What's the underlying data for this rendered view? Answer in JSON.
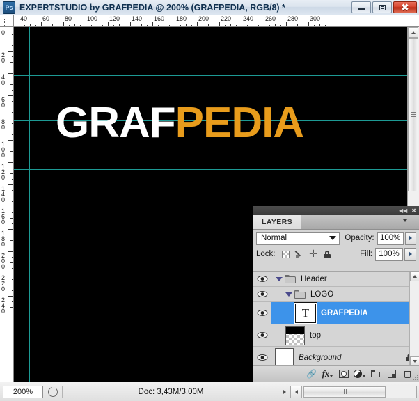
{
  "window": {
    "app_icon": "photoshop-icon",
    "title": "EXPERTSTUDIO by GRAFPEDIA @ 200% (GRAFPEDIA, RGB/8) *",
    "minimize_label": "",
    "maximize_label": "",
    "close_label": "✖"
  },
  "rulers": {
    "unit_origin": "0",
    "horizontal_labels": [
      "40",
      "60",
      "80",
      "100",
      "120",
      "140",
      "160",
      "180",
      "200",
      "220",
      "240",
      "260",
      "280",
      "300"
    ],
    "vertical_labels": [
      "0",
      "20",
      "40",
      "60",
      "80",
      "100",
      "120",
      "140",
      "160",
      "180",
      "200",
      "220",
      "240"
    ]
  },
  "canvas": {
    "background_color": "#000000",
    "guide_color": "#1d9a94",
    "logo_part_1": "GRAF",
    "logo_part_1_color": "#ffffff",
    "logo_part_2": "PEDIA",
    "logo_part_2_color": "#e89c1c"
  },
  "statusbar": {
    "zoom_level": "200%",
    "preview_icon": "document-preview-icon",
    "doc_info": "Doc: 3,43M/3,00M",
    "expand_arrow": "▶"
  },
  "layers_panel": {
    "collapse_icon": "◀◀",
    "close_icon": "✖",
    "tab_label": "LAYERS",
    "menu_icon": "panel-menu-icon",
    "blend_mode": "Normal",
    "blend_modes": [
      "Normal"
    ],
    "opacity_label": "Opacity:",
    "opacity_value": "100%",
    "lock_label": "Lock:",
    "lock_icons": [
      "lock-transparent-pixels-icon",
      "lock-image-pixels-icon",
      "lock-position-icon",
      "lock-all-icon"
    ],
    "fill_label": "Fill:",
    "fill_value": "100%",
    "rows": [
      {
        "name": "Header",
        "type": "group",
        "visible": true,
        "expanded": true,
        "indent": 0,
        "selected": false,
        "locked": false
      },
      {
        "name": "LOGO",
        "type": "group",
        "visible": true,
        "expanded": true,
        "indent": 1,
        "selected": false,
        "locked": false
      },
      {
        "name": "GRAFPEDIA",
        "type": "text",
        "thumb_glyph": "T",
        "visible": true,
        "indent": 2,
        "selected": true,
        "locked": false
      },
      {
        "name": "top",
        "type": "pixel",
        "visible": true,
        "indent": 2,
        "selected": false,
        "locked": false
      },
      {
        "name": "Background",
        "type": "background",
        "visible": true,
        "indent": 1,
        "selected": false,
        "locked": true
      }
    ],
    "footer_buttons": [
      "link-layers-icon",
      "layer-style-fx-icon",
      "add-layer-mask-icon",
      "new-adjustment-layer-icon",
      "new-group-icon",
      "new-layer-icon",
      "delete-layer-icon"
    ]
  }
}
